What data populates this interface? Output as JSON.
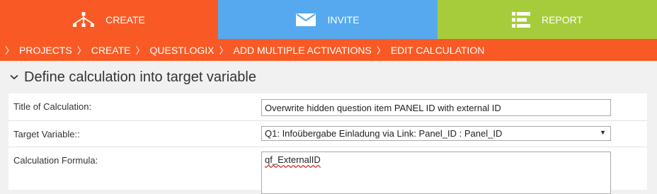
{
  "nav": {
    "tabs": [
      {
        "label": "CREATE",
        "icon": "sitemap-icon",
        "color": "#f95a25"
      },
      {
        "label": "INVITE",
        "icon": "envelope-icon",
        "color": "#56a9ee"
      },
      {
        "label": "REPORT",
        "icon": "list-icon",
        "color": "#a6cc3c"
      }
    ]
  },
  "breadcrumb": {
    "separator": "〉",
    "items": [
      "PROJECTS",
      "CREATE",
      "QUESTLOGIX",
      "ADD MULTIPLE ACTIVATIONS",
      "EDIT CALCULATION"
    ]
  },
  "section": {
    "title": "Define calculation into target variable",
    "icon": "chevron-down-icon"
  },
  "form": {
    "title_label": "Title of Calculation:",
    "title_value": "Overwrite hidden question item PANEL ID with external ID",
    "target_label": "Target Variable::",
    "target_value": "Q1: Infoübergabe Einladung via Link: Panel_ID : Panel_ID",
    "target_arrow": "▼",
    "formula_label": "Calculation Formula:",
    "formula_value": "qf_ExternalID"
  }
}
